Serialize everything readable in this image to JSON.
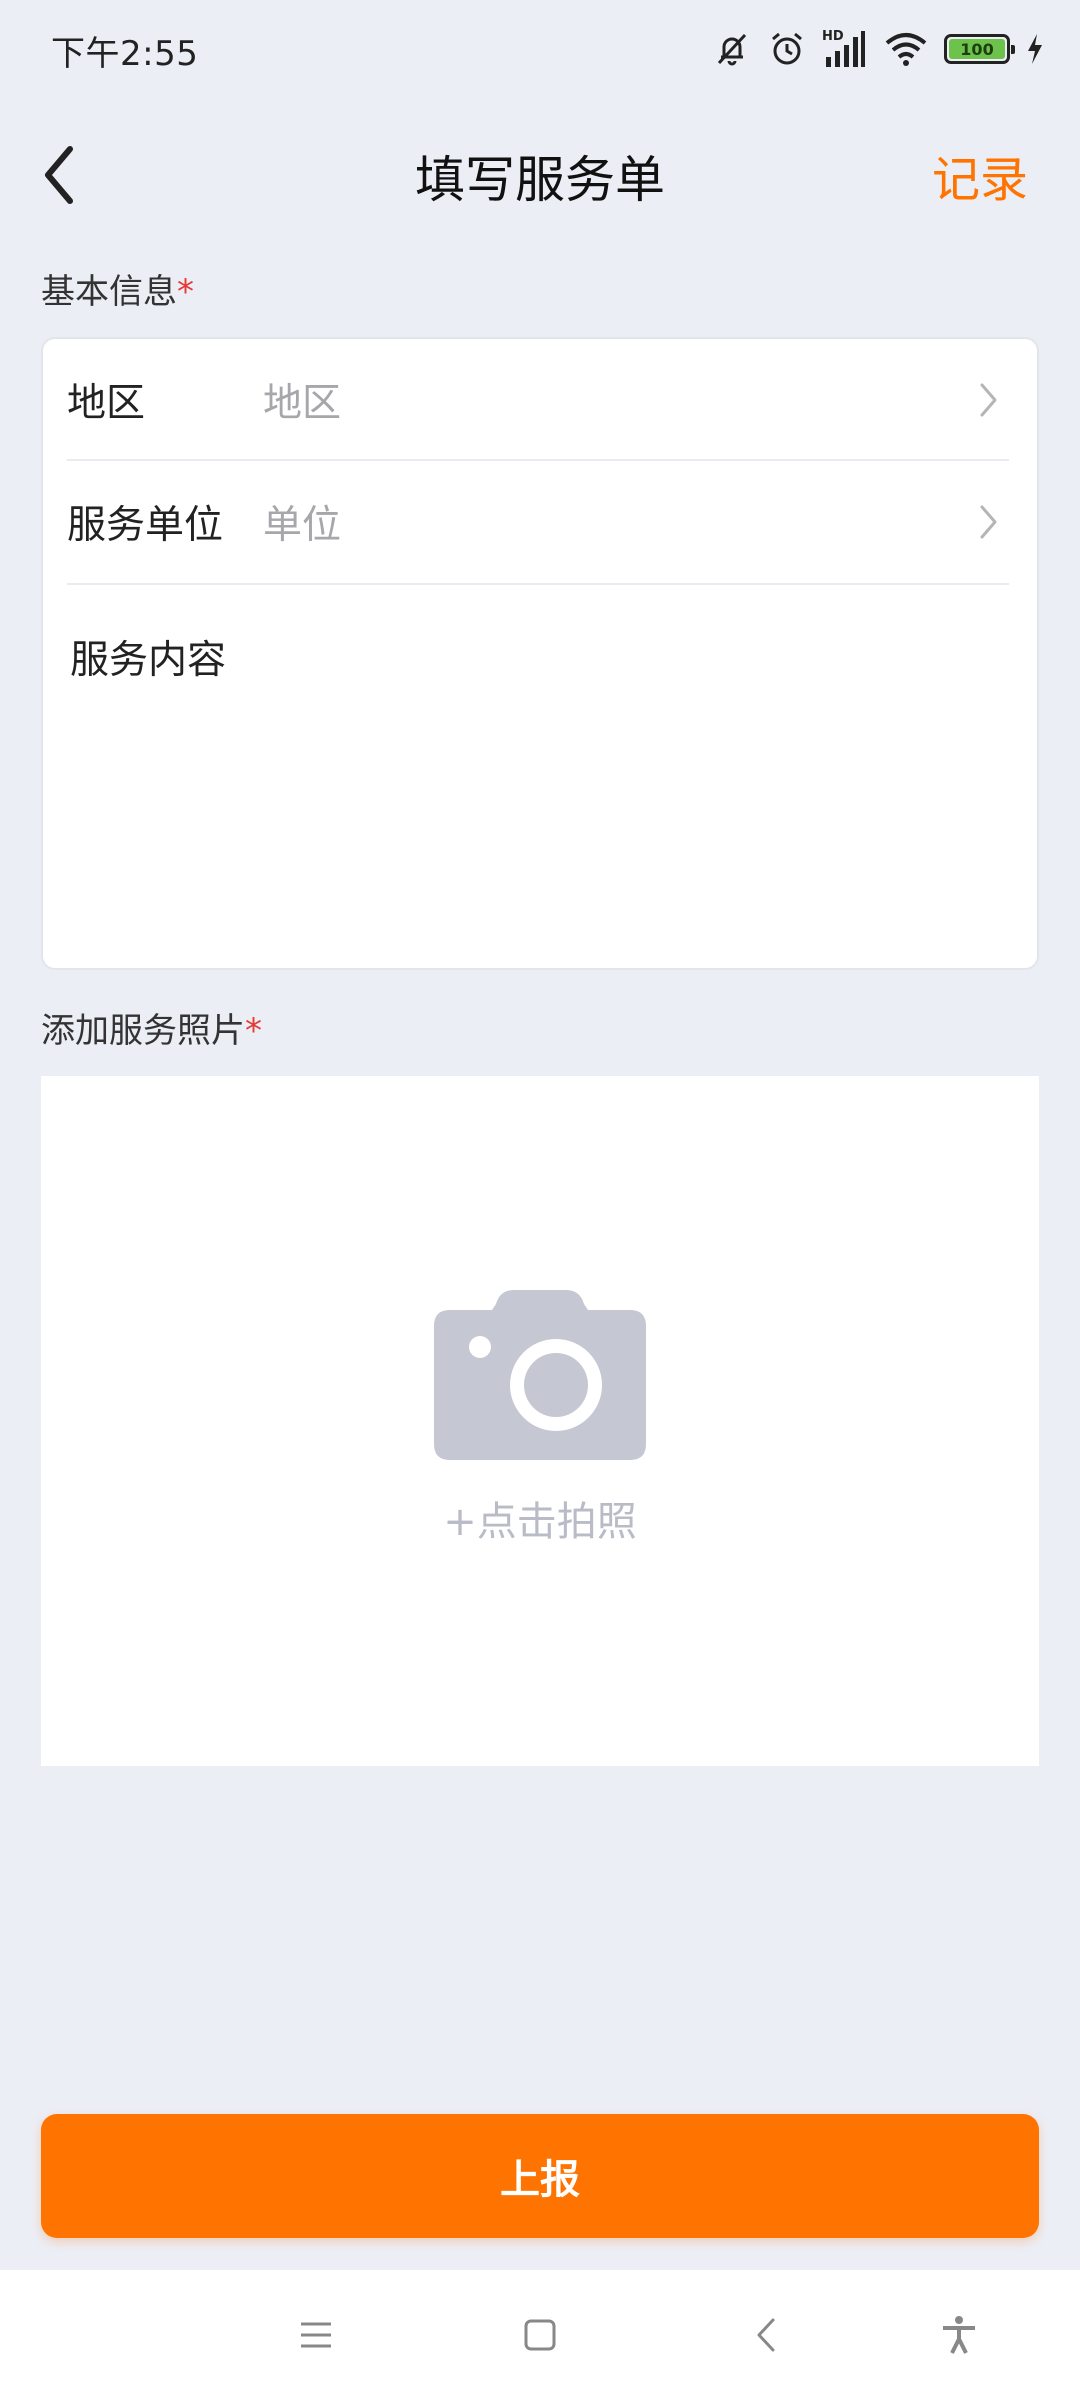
{
  "status_bar": {
    "time": "下午2:55",
    "network_label": "HD",
    "battery_level": "100",
    "icons": [
      "mute-icon",
      "alarm-icon",
      "signal-icon",
      "wifi-icon",
      "battery-icon",
      "charging-icon"
    ]
  },
  "header": {
    "title": "填写服务单",
    "record_label": "记录",
    "back_icon": "back-arrow-icon"
  },
  "basic_info": {
    "label": "基本信息",
    "required_mark": "*",
    "fields": [
      {
        "label": "地区",
        "placeholder": "地区"
      },
      {
        "label": "服务单位",
        "placeholder": "单位"
      }
    ],
    "content_label": "服务内容",
    "content_value": ""
  },
  "photos": {
    "label": "添加服务照片",
    "required_mark": "*",
    "hint": "+点击拍照",
    "icon": "camera-icon"
  },
  "submit": {
    "label": "上报"
  },
  "nav_bar": {
    "icons": [
      "menu-icon",
      "home-icon",
      "back-icon",
      "accessibility-icon"
    ]
  },
  "colors": {
    "accent": "#ff7300",
    "required": "#e53935",
    "background": "#eceef5",
    "placeholder": "#a7a7ab"
  }
}
